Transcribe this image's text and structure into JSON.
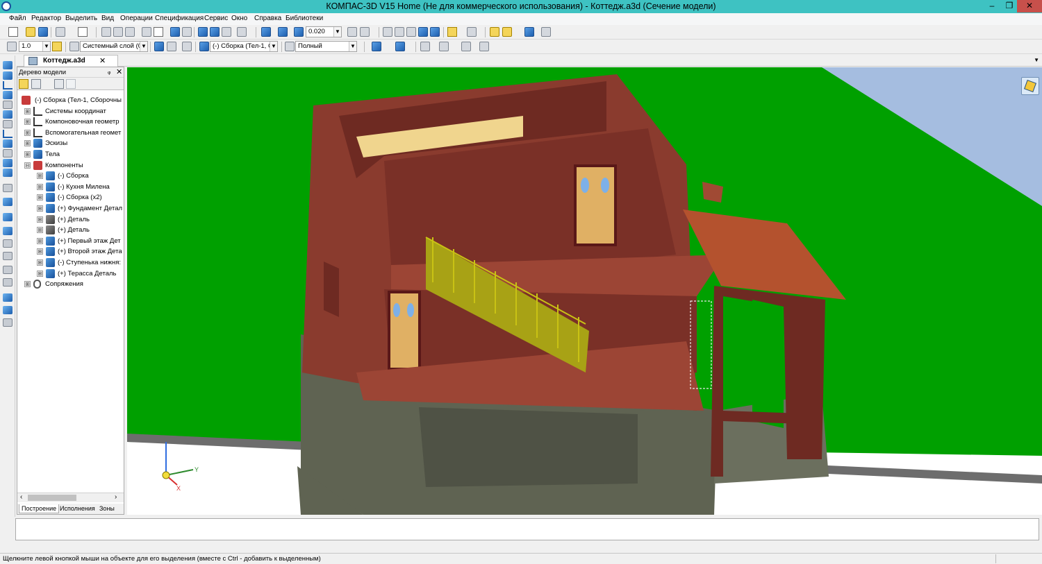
{
  "window": {
    "title": "КОМПАС-3D V15 Home (Не для коммерческого использования) - Коттедж.a3d (Сечение модели)",
    "minimize": "‒",
    "maximize": "❐",
    "close": "✕"
  },
  "menu": {
    "items": [
      "Файл",
      "Редактор",
      "Выделить",
      "Вид",
      "Операции",
      "Спецификация",
      "Сервис",
      "Окно",
      "Справка",
      "Библиотеки"
    ]
  },
  "toolbar1": {
    "zoom_value": "0.020"
  },
  "toolbar2": {
    "step_value": "1.0",
    "layer_value": "Системный слой (0)",
    "assembly_value": "(-) Сборка (Тел-1, С",
    "mode_value": "Полный"
  },
  "doc_tab": {
    "label": "Коттедж.a3d",
    "close": "✕"
  },
  "tree": {
    "header": "Дерево модели",
    "pin": "ᵩ",
    "close": "✕",
    "root": "(-) Сборка (Тел-1, Сборочны",
    "nodes": [
      {
        "label": "Системы координат",
        "level": 1,
        "expander": "⊞",
        "icon": "axis"
      },
      {
        "label": "Компоновочная геометр",
        "level": 1,
        "expander": "⊞",
        "icon": "axis"
      },
      {
        "label": "Вспомогательная геомет",
        "level": 1,
        "expander": "⊞",
        "icon": "axis"
      },
      {
        "label": "Эскизы",
        "level": 1,
        "expander": "⊞",
        "icon": "blue"
      },
      {
        "label": "Тела",
        "level": 1,
        "expander": "⊞",
        "icon": "blue"
      },
      {
        "label": "Компоненты",
        "level": 1,
        "expander": "⊟",
        "icon": "red"
      },
      {
        "label": "(-) Сборка",
        "level": 2,
        "expander": "⊞",
        "icon": "blue"
      },
      {
        "label": "(-) Кухня Милена",
        "level": 2,
        "expander": "⊞",
        "icon": "blue"
      },
      {
        "label": "(-) Сборка (x2)",
        "level": 2,
        "expander": "⊞",
        "icon": "blue"
      },
      {
        "label": "(+) Фундамент Детал",
        "level": 2,
        "expander": "⊞",
        "icon": "blue"
      },
      {
        "label": "(+) Деталь",
        "level": 2,
        "expander": "⊞",
        "icon": "dark"
      },
      {
        "label": "(+) Деталь",
        "level": 2,
        "expander": "⊞",
        "icon": "dark"
      },
      {
        "label": "(+) Первый этаж Дет",
        "level": 2,
        "expander": "⊞",
        "icon": "blue"
      },
      {
        "label": "(+) Второй этаж Дета",
        "level": 2,
        "expander": "⊞",
        "icon": "blue"
      },
      {
        "label": "(-) Ступенька нижня:",
        "level": 2,
        "expander": "⊞",
        "icon": "blue"
      },
      {
        "label": "(+) Терасса Деталь",
        "level": 2,
        "expander": "⊞",
        "icon": "blue"
      },
      {
        "label": "Сопряжения",
        "level": 1,
        "expander": "⊞",
        "icon": "clip"
      }
    ],
    "scroll_left": "‹",
    "scroll_right": "›",
    "tabs": [
      "Построение",
      "Исполнения",
      "Зоны"
    ]
  },
  "axes": {
    "y_label": "Y",
    "x_label": "X"
  },
  "status": {
    "message": "Щелкните левой кнопкой мыши на объекте для его выделения (вместе с Ctrl - добавить к выделенным)"
  },
  "colors": {
    "title_bar": "#3ec2c2",
    "viewport_ground": "#00a000",
    "viewport_sky": "#ffffff",
    "walls": "#8a3b2e",
    "roof": "#b4522e",
    "foundation": "#5f6352",
    "railing": "#b8b418",
    "doors": "#e0b064",
    "selection": "#f4d55a"
  }
}
